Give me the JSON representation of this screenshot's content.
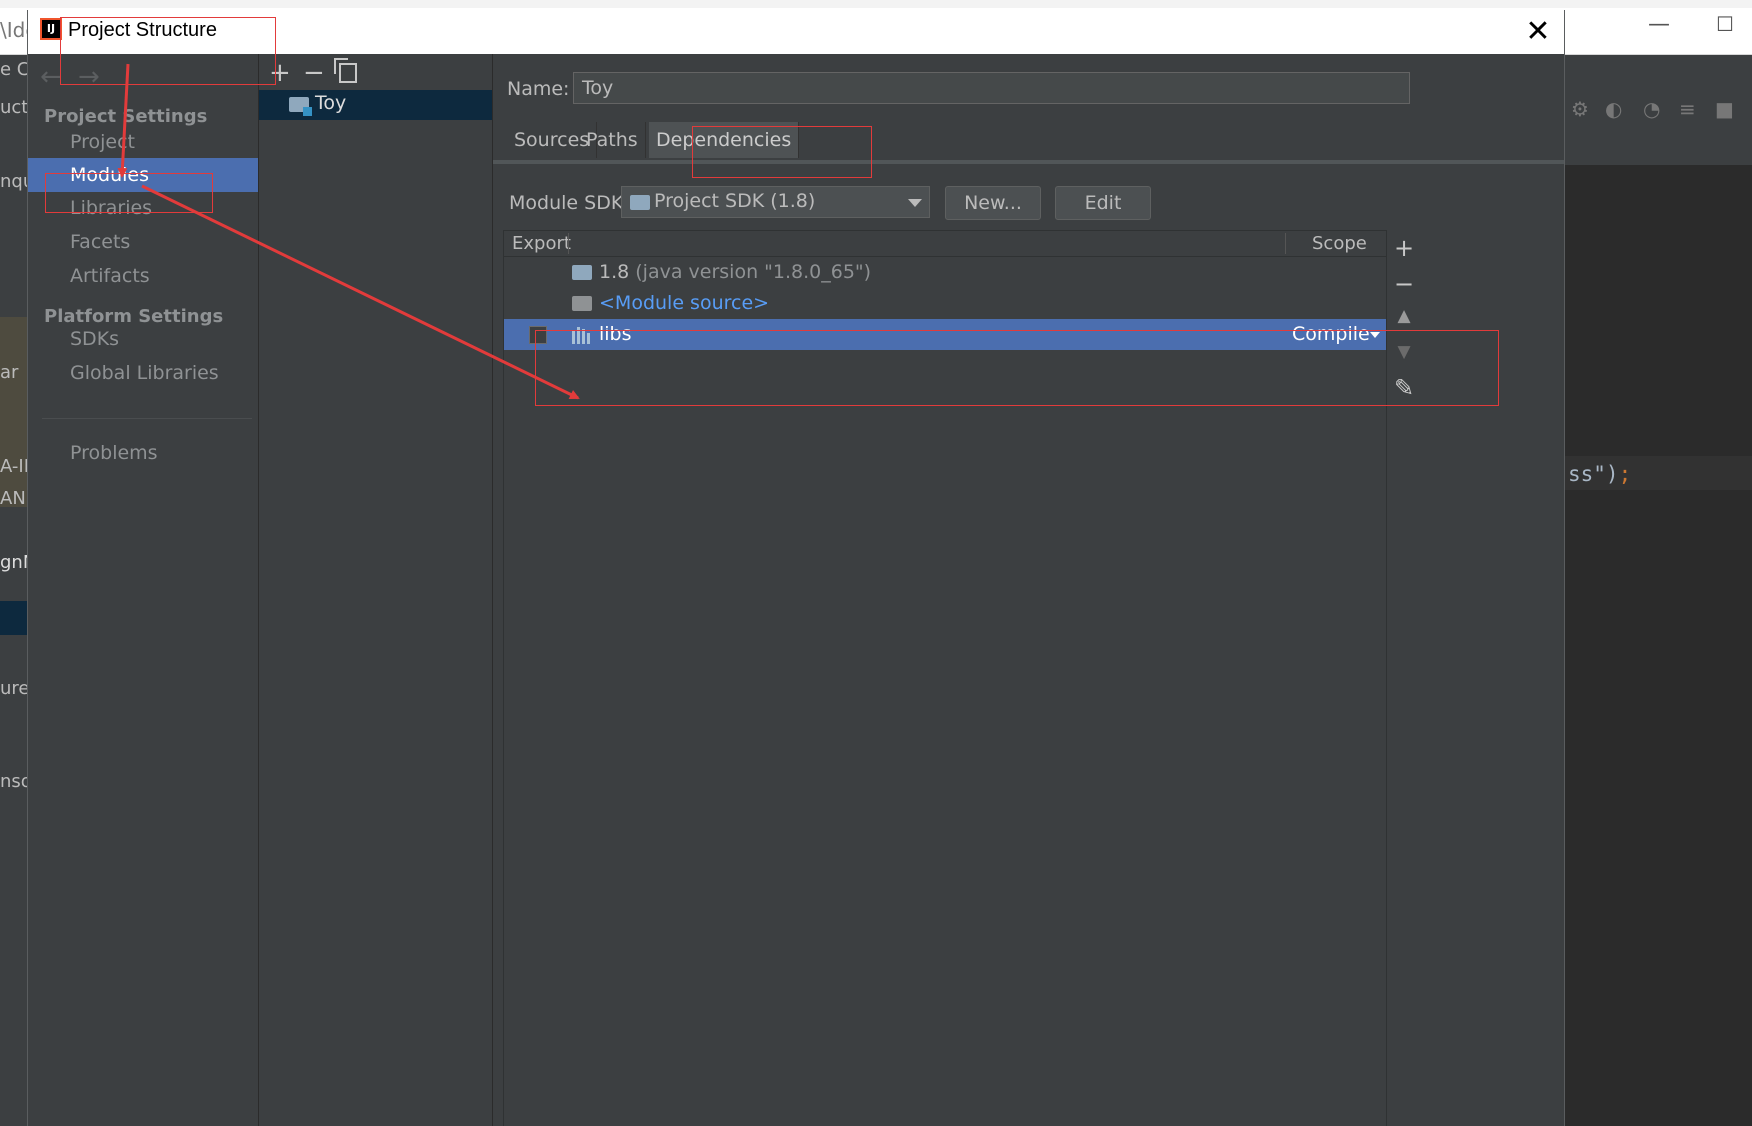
{
  "background_ide": {
    "title_fragment": "\\Ide",
    "left_fragments": [
      "e  C",
      "uct",
      "nqu",
      "ar",
      "A-IN",
      "AN",
      "gnN",
      "ure",
      "nso"
    ],
    "code_fragment": "ss\")",
    "code_semicolon": ";",
    "minimize_glyph": "—",
    "maximize_glyph": "☐"
  },
  "dialog": {
    "title": "Project Structure",
    "close_glyph": "✕"
  },
  "settings_nav": {
    "project_settings_header": "Project Settings",
    "platform_settings_header": "Platform Settings",
    "items": [
      {
        "label": "Project"
      },
      {
        "label": "Modules"
      },
      {
        "label": "Libraries"
      },
      {
        "label": "Facets"
      },
      {
        "label": "Artifacts"
      },
      {
        "label": "SDKs"
      },
      {
        "label": "Global Libraries"
      },
      {
        "label": "Problems"
      }
    ],
    "selected": "Modules"
  },
  "modules_list": {
    "add_glyph": "+",
    "remove_glyph": "−",
    "modules": [
      {
        "name": "Toy"
      }
    ]
  },
  "module_detail": {
    "name_label": "Name:",
    "name_value": "Toy",
    "tabs": [
      {
        "label": "Sources"
      },
      {
        "label": "Paths"
      },
      {
        "label": "Dependencies"
      }
    ],
    "active_tab": "Dependencies",
    "sdk_label": "Module SDK:",
    "sdk_value": "Project SDK (1.8)",
    "new_button": "New...",
    "edit_button": "Edit",
    "table": {
      "header_export": "Export",
      "header_scope": "Scope",
      "rows": [
        {
          "name": "1.8",
          "detail": "(java version \"1.8.0_65\")"
        },
        {
          "name": "<Module source>"
        },
        {
          "name": "libs",
          "scope": "Compile",
          "export": false
        }
      ]
    },
    "side_tools": [
      "+",
      "−",
      "▲",
      "▼",
      "✎"
    ]
  },
  "colors": {
    "selection": "#4b6eaf",
    "annotation_red": "#e23b3b",
    "link_blue": "#589df6"
  }
}
